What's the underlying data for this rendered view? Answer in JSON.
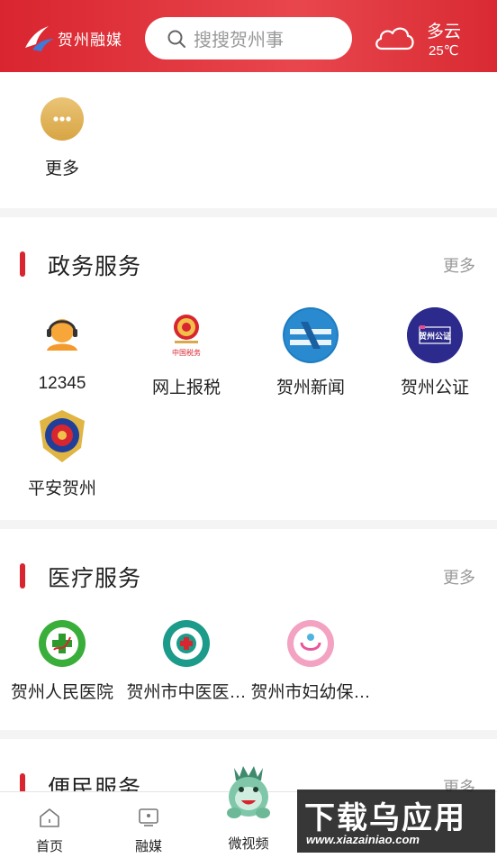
{
  "header": {
    "logo_text": "贺州融媒",
    "search_placeholder": "搜搜贺州事",
    "weather_condition": "多云",
    "weather_temp": "25℃"
  },
  "top_section": {
    "more_label": "更多"
  },
  "gov_services": {
    "title": "政务服务",
    "more": "更多",
    "items": [
      {
        "label": "12345",
        "icon": "customer-service-icon"
      },
      {
        "label": "网上报税",
        "icon": "tax-emblem-icon"
      },
      {
        "label": "贺州新闻",
        "icon": "hezhou-news-icon"
      },
      {
        "label": "贺州公证",
        "icon": "notary-icon"
      },
      {
        "label": "平安贺州",
        "icon": "police-badge-icon"
      }
    ]
  },
  "medical_services": {
    "title": "医疗服务",
    "more": "更多",
    "items": [
      {
        "label": "贺州人民医院",
        "icon": "peoples-hospital-icon"
      },
      {
        "label": "贺州市中医医…",
        "icon": "tcm-hospital-icon"
      },
      {
        "label": "贺州市妇幼保…",
        "icon": "maternal-child-hospital-icon"
      }
    ]
  },
  "convenience_services": {
    "title": "便民服务",
    "more": "更多"
  },
  "tabbar": {
    "tabs": [
      {
        "label": "首页",
        "icon": "home-icon"
      },
      {
        "label": "融媒",
        "icon": "media-icon"
      },
      {
        "label": "微视频",
        "icon": "mascot-icon"
      }
    ]
  },
  "watermark": {
    "big": "下载乌应用",
    "small": "www.xiazainiao.com"
  },
  "colors": {
    "brand_red": "#d9252f",
    "gold": "#d9a94a"
  }
}
